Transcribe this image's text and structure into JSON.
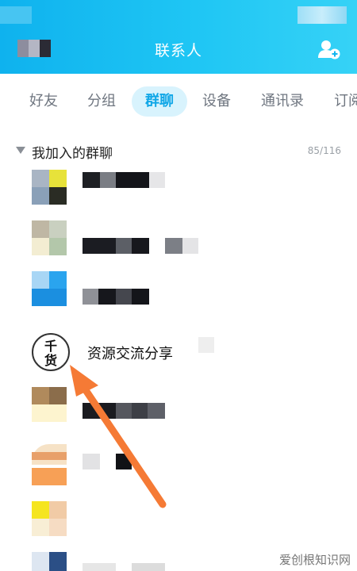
{
  "header": {
    "title": "联系人",
    "icons": {
      "add_contact": "add-contact-icon"
    },
    "accent": "#12b5ef"
  },
  "tabs": [
    {
      "label": "好友",
      "active": false
    },
    {
      "label": "分组",
      "active": false
    },
    {
      "label": "群聊",
      "active": true
    },
    {
      "label": "设备",
      "active": false
    },
    {
      "label": "通讯录",
      "active": false
    },
    {
      "label": "订阅",
      "active": false
    }
  ],
  "section": {
    "title": "我加入的群聊",
    "count": "85/116"
  },
  "groups": [
    {
      "name": ""
    },
    {
      "name": ""
    },
    {
      "name": ""
    },
    {
      "name": "资源交流分享",
      "avatar_text": "千货"
    },
    {
      "name": ""
    },
    {
      "name": ""
    },
    {
      "name": ""
    },
    {
      "name": ""
    }
  ],
  "watermark": "爱创根知识网"
}
